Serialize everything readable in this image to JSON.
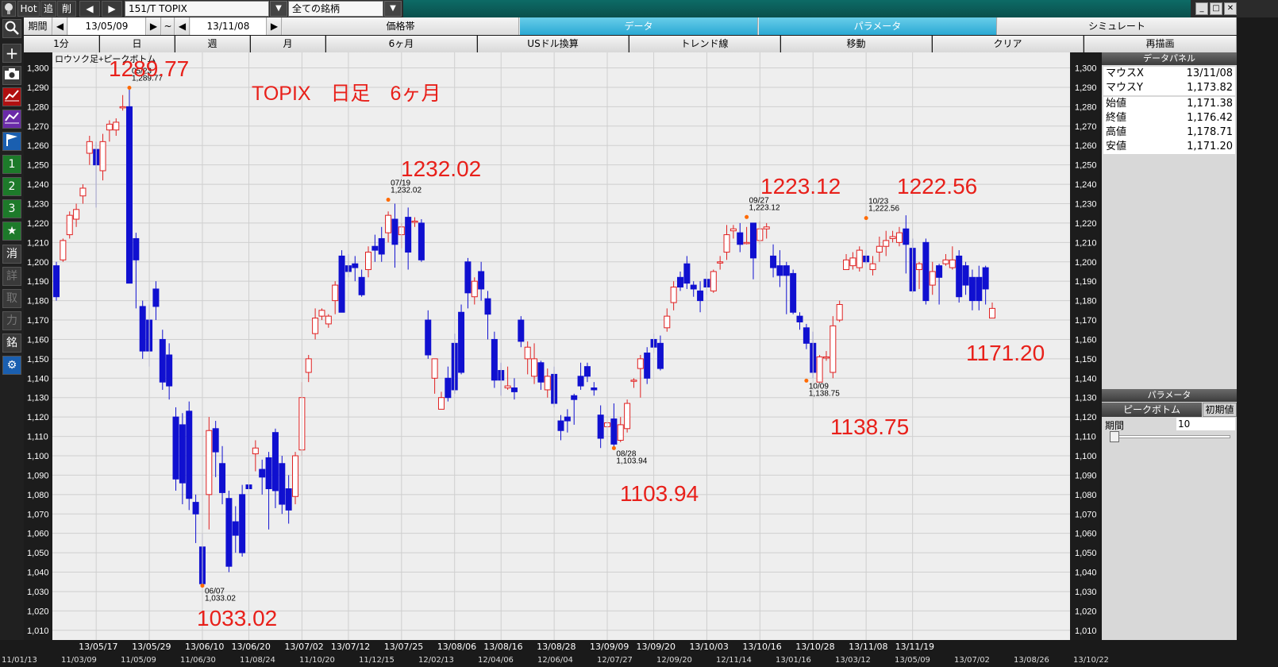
{
  "topbar": {
    "hot": "Hot",
    "add": "追",
    "del": "削",
    "symbol": "151/T TOPIX",
    "filter": "全ての銘柄"
  },
  "period_row": {
    "label": "期間",
    "from": "13/05/09",
    "tilde": "~",
    "to": "13/11/08",
    "tabs": [
      "価格帯",
      "データ",
      "パラメータ",
      "シミュレート"
    ]
  },
  "interval_row": {
    "items": [
      "1分",
      "日",
      "週",
      "月",
      "6ヶ月",
      "USドル換算",
      "トレンド線",
      "移動",
      "クリア",
      "再描画"
    ],
    "active_index": 1
  },
  "left_toolbar": {
    "icons": [
      "search-icon",
      "plus-icon",
      "camera-icon",
      "line-chart-icon",
      "compare-icon",
      "flag-icon"
    ],
    "numbers": [
      "1",
      "2",
      "3"
    ],
    "star": "★",
    "kanji": [
      "消",
      "詳",
      "取",
      "力",
      "銘"
    ],
    "gear": "⚙"
  },
  "chart_data": {
    "type": "candlestick",
    "legend": "ロウソク足+ピークボトム",
    "title_annotation": "TOPIX　日足　6ヶ月",
    "ylim": [
      1005,
      1308
    ],
    "yticks": [
      1010,
      1020,
      1030,
      1040,
      1050,
      1060,
      1070,
      1080,
      1090,
      1100,
      1110,
      1120,
      1130,
      1140,
      1150,
      1160,
      1170,
      1180,
      1190,
      1200,
      1210,
      1220,
      1230,
      1240,
      1250,
      1260,
      1270,
      1280,
      1290,
      1300
    ],
    "ytick_labels": [
      "1,010",
      "1,020",
      "1,030",
      "1,040",
      "1,050",
      "1,060",
      "1,070",
      "1,080",
      "1,090",
      "1,100",
      "1,110",
      "1,120",
      "1,130",
      "1,140",
      "1,150",
      "1,160",
      "1,170",
      "1,180",
      "1,190",
      "1,200",
      "1,210",
      "1,220",
      "1,230",
      "1,240",
      "1,250",
      "1,260",
      "1,270",
      "1,280",
      "1,290",
      "1,300"
    ],
    "xticks": [
      "13/05/17",
      "13/05/29",
      "13/06/10",
      "13/06/20",
      "13/07/02",
      "13/07/12",
      "13/07/25",
      "13/08/06",
      "13/08/16",
      "13/08/28",
      "13/09/09",
      "13/09/20",
      "13/10/03",
      "13/10/16",
      "13/10/28",
      "13/11/08",
      "13/11/19"
    ],
    "candles": [
      [
        1198,
        1182,
        1200,
        1180
      ],
      [
        1201,
        1211,
        1212,
        1200
      ],
      [
        1214,
        1224,
        1226,
        1212
      ],
      [
        1222,
        1227,
        1230,
        1218
      ],
      [
        1234,
        1238,
        1240,
        1230
      ],
      [
        1256,
        1262,
        1265,
        1250
      ],
      [
        1258,
        1250,
        1262,
        1228
      ],
      [
        1247,
        1262,
        1266,
        1242
      ],
      [
        1268,
        1271,
        1273,
        1262
      ],
      [
        1268,
        1272,
        1274,
        1265
      ],
      [
        1280,
        1280,
        1286,
        1278
      ],
      [
        1280,
        1189,
        1290,
        1189
      ],
      [
        1212,
        1201,
        1215,
        1176
      ],
      [
        1177,
        1154,
        1180,
        1150
      ],
      [
        1170,
        1154,
        1178,
        1146
      ],
      [
        1186,
        1177,
        1190,
        1170
      ],
      [
        1160,
        1138,
        1165,
        1134
      ],
      [
        1152,
        1136,
        1158,
        1129
      ],
      [
        1120,
        1088,
        1125,
        1082
      ],
      [
        1116,
        1086,
        1122,
        1075
      ],
      [
        1123,
        1078,
        1128,
        1072
      ],
      [
        1076,
        1070,
        1080,
        1055
      ],
      [
        1053,
        1034,
        1060,
        1033
      ],
      [
        1080,
        1113,
        1120,
        1062
      ],
      [
        1114,
        1102,
        1118,
        1089
      ],
      [
        1096,
        1081,
        1105,
        1075
      ],
      [
        1078,
        1043,
        1082,
        1040
      ],
      [
        1066,
        1059,
        1074,
        1050
      ],
      [
        1080,
        1050,
        1085,
        1048
      ],
      [
        1085,
        1083,
        1090,
        1070
      ],
      [
        1101,
        1104,
        1108,
        1092
      ],
      [
        1093,
        1089,
        1098,
        1080
      ],
      [
        1099,
        1083,
        1102,
        1062
      ],
      [
        1112,
        1082,
        1114,
        1073
      ],
      [
        1096,
        1075,
        1100,
        1070
      ],
      [
        1083,
        1072,
        1090,
        1065
      ],
      [
        1079,
        1100,
        1102,
        1075
      ],
      [
        1103,
        1130,
        1138,
        1100
      ],
      [
        1143,
        1150,
        1152,
        1138
      ],
      [
        1163,
        1171,
        1176,
        1160
      ],
      [
        1172,
        1175,
        1176,
        1170
      ],
      [
        1168,
        1172,
        1173,
        1166
      ],
      [
        1180,
        1188,
        1190,
        1173
      ],
      [
        1203,
        1174,
        1206,
        1174
      ],
      [
        1198,
        1195,
        1204,
        1192
      ],
      [
        1199,
        1197,
        1203,
        1190
      ],
      [
        1192,
        1183,
        1196,
        1182
      ],
      [
        1196,
        1205,
        1208,
        1192
      ],
      [
        1208,
        1206,
        1214,
        1200
      ],
      [
        1212,
        1204,
        1218,
        1200
      ],
      [
        1215,
        1224,
        1226,
        1210
      ],
      [
        1222,
        1209,
        1230,
        1197
      ],
      [
        1214,
        1218,
        1220,
        1207
      ],
      [
        1223,
        1205,
        1228,
        1196
      ],
      [
        1221,
        1221,
        1223,
        1218
      ],
      [
        1220,
        1201,
        1222,
        1200
      ],
      [
        1170,
        1152,
        1175,
        1150
      ],
      [
        1140,
        1150,
        1150,
        1132
      ],
      [
        1124,
        1130,
        1133,
        1128
      ],
      [
        1140,
        1130,
        1146,
        1128
      ],
      [
        1158,
        1134,
        1163,
        1132
      ],
      [
        1174,
        1143,
        1178,
        1142
      ],
      [
        1200,
        1184,
        1202,
        1176
      ],
      [
        1182,
        1190,
        1192,
        1178
      ],
      [
        1195,
        1186,
        1200,
        1180
      ],
      [
        1181,
        1173,
        1185,
        1160
      ],
      [
        1160,
        1139,
        1164,
        1135
      ],
      [
        1144,
        1139,
        1148,
        1131
      ],
      [
        1135,
        1136,
        1146,
        1134
      ],
      [
        1135,
        1133,
        1140,
        1129
      ],
      [
        1170,
        1159,
        1172,
        1156
      ],
      [
        1150,
        1156,
        1159,
        1142
      ],
      [
        1141,
        1150,
        1158,
        1137
      ],
      [
        1148,
        1138,
        1149,
        1134
      ],
      [
        1134,
        1141,
        1145,
        1130
      ],
      [
        1142,
        1127,
        1146,
        1125
      ],
      [
        1118,
        1113,
        1121,
        1108
      ],
      [
        1120,
        1118,
        1124,
        1112
      ],
      [
        1131,
        1129,
        1132,
        1116
      ],
      [
        1141,
        1136,
        1148,
        1134
      ],
      [
        1146,
        1141,
        1148,
        1138
      ],
      [
        1135,
        1134,
        1138,
        1131
      ],
      [
        1121,
        1109,
        1126,
        1104
      ],
      [
        1115,
        1117,
        1118,
        1108
      ],
      [
        1119,
        1106,
        1127,
        1103
      ],
      [
        1108,
        1116,
        1120,
        1107
      ],
      [
        1114,
        1127,
        1129,
        1112
      ],
      [
        1139,
        1139,
        1140,
        1135
      ],
      [
        1145,
        1150,
        1152,
        1130
      ],
      [
        1153,
        1140,
        1156,
        1137
      ],
      [
        1160,
        1156,
        1163,
        1153
      ],
      [
        1158,
        1145,
        1162,
        1144
      ],
      [
        1166,
        1172,
        1176,
        1164
      ],
      [
        1179,
        1187,
        1190,
        1175
      ],
      [
        1192,
        1187,
        1195,
        1185
      ],
      [
        1199,
        1189,
        1203,
        1186
      ],
      [
        1188,
        1186,
        1190,
        1182
      ],
      [
        1185,
        1180,
        1190,
        1174
      ],
      [
        1191,
        1187,
        1195,
        1183
      ],
      [
        1185,
        1195,
        1196,
        1184
      ],
      [
        1200,
        1200,
        1203,
        1196
      ],
      [
        1205,
        1214,
        1219,
        1201
      ],
      [
        1216,
        1217,
        1219,
        1212
      ],
      [
        1215,
        1209,
        1220,
        1205
      ],
      [
        1210,
        1210,
        1218,
        1209
      ],
      [
        1220,
        1202,
        1219,
        1191
      ],
      [
        1211,
        1217,
        1221,
        1209
      ],
      [
        1217,
        1218,
        1220,
        1212
      ],
      [
        1203,
        1197,
        1209,
        1192
      ],
      [
        1198,
        1193,
        1206,
        1187
      ],
      [
        1198,
        1193,
        1200,
        1173
      ],
      [
        1194,
        1174,
        1196,
        1173
      ],
      [
        1172,
        1169,
        1174,
        1165
      ],
      [
        1166,
        1158,
        1168,
        1155
      ],
      [
        1158,
        1143,
        1164,
        1140
      ],
      [
        1138,
        1151,
        1152,
        1139
      ],
      [
        1151,
        1151,
        1154,
        1149
      ],
      [
        1143,
        1167,
        1172,
        1140
      ],
      [
        1170,
        1178,
        1180,
        1169
      ],
      [
        1196,
        1201,
        1204,
        1197
      ],
      [
        1198,
        1202,
        1205,
        1196
      ],
      [
        1197,
        1206,
        1208,
        1195
      ],
      [
        1203,
        1200,
        1206,
        1199
      ],
      [
        1196,
        1199,
        1203,
        1193
      ],
      [
        1205,
        1208,
        1213,
        1200
      ],
      [
        1208,
        1211,
        1216,
        1203
      ],
      [
        1212,
        1213,
        1216,
        1210
      ],
      [
        1210,
        1215,
        1218,
        1208
      ],
      [
        1217,
        1209,
        1224,
        1194
      ],
      [
        1207,
        1185,
        1212,
        1184
      ],
      [
        1196,
        1199,
        1200,
        1186
      ],
      [
        1210,
        1180,
        1212,
        1178
      ],
      [
        1188,
        1195,
        1200,
        1183
      ],
      [
        1198,
        1192,
        1199,
        1178
      ],
      [
        1199,
        1201,
        1204,
        1198
      ],
      [
        1197,
        1201,
        1208,
        1196
      ],
      [
        1203,
        1182,
        1206,
        1179
      ],
      [
        1198,
        1188,
        1200,
        1183
      ],
      [
        1192,
        1180,
        1196,
        1175
      ],
      [
        1192,
        1180,
        1198,
        1175
      ],
      [
        1197,
        1186,
        1198,
        1178
      ],
      [
        1171,
        1176,
        1179,
        1171
      ]
    ],
    "peaks": [
      {
        "date": "05/23",
        "value": "1,289.77",
        "label": "1289.77",
        "type": "peak"
      },
      {
        "date": "06/07",
        "value": "1,033.02",
        "label": "1033.02",
        "type": "bottom"
      },
      {
        "date": "07/19",
        "value": "1,232.02",
        "label": "1232.02",
        "type": "peak"
      },
      {
        "date": "08/28",
        "value": "1,103.94",
        "label": "1103.94",
        "type": "bottom"
      },
      {
        "date": "09/27",
        "value": "1,223.12",
        "label": "1223.12",
        "type": "peak"
      },
      {
        "date": "10/09",
        "value": "1,138.75",
        "label": "1138.75",
        "type": "bottom"
      },
      {
        "date": "10/23",
        "value": "1,222.56",
        "label": "1222.56",
        "type": "peak"
      }
    ],
    "last_annotation": "1171.20",
    "colors": {
      "up": "#e02020",
      "down": "#1010d0",
      "annot": "#e8201a",
      "bg": "#eeeeee",
      "grid": "#cfcfcf"
    }
  },
  "data_panel": {
    "title": "データパネル",
    "rows": [
      {
        "k": "マウスX",
        "v": "13/11/08"
      },
      {
        "k": "マウスY",
        "v": "1,173.82"
      },
      {
        "k": "始値",
        "v": "1,171.38"
      },
      {
        "k": "終値",
        "v": "1,176.42"
      },
      {
        "k": "高値",
        "v": "1,178.71"
      },
      {
        "k": "安値",
        "v": "1,171.20"
      }
    ]
  },
  "param_panel": {
    "title": "パラメータ",
    "tab": "ピークボトム",
    "reset": "初期値",
    "period_label": "期間",
    "period_value": "10"
  },
  "bottom_axis": {
    "main": [
      "13/05/17",
      "13/05/29",
      "13/06/10",
      "13/06/20",
      "13/07/02",
      "13/07/12",
      "13/07/25",
      "13/08/06",
      "13/08/16",
      "13/08/28",
      "13/09/09",
      "13/09/20",
      "13/10/03",
      "13/10/16",
      "13/10/28",
      "13/11/08",
      "13/11/19"
    ],
    "overview": [
      "11/01/13",
      "11/03/09",
      "11/05/09",
      "11/06/30",
      "11/08/24",
      "11/10/20",
      "11/12/15",
      "12/02/13",
      "12/04/06",
      "12/06/04",
      "12/07/27",
      "12/09/20",
      "12/11/14",
      "13/01/16",
      "13/03/12",
      "13/05/09",
      "13/07/02",
      "13/08/26",
      "13/10/22"
    ]
  }
}
